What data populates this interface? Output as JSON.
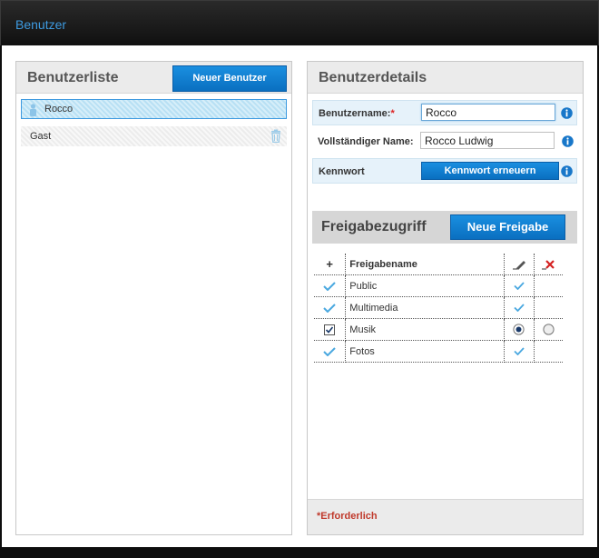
{
  "app": {
    "title": "Benutzer"
  },
  "user_list": {
    "title": "Benutzerliste",
    "new_user_label": "Neuer Benutzer",
    "users": [
      {
        "name": "Rocco",
        "selected": true
      },
      {
        "name": "Gast",
        "selected": false
      }
    ]
  },
  "user_details": {
    "title": "Benutzerdetails",
    "username_label": "Benutzername:",
    "username_required": "*",
    "username_value": "Rocco",
    "fullname_label": "Vollständiger Name:",
    "fullname_value": "Rocco Ludwig",
    "password_label": "Kennwort",
    "renew_password_label": "Kennwort erneuern"
  },
  "shares": {
    "title": "Freigabezugriff",
    "new_share_label": "Neue Freigabe",
    "header": {
      "add": "+",
      "name": "Freigabename"
    },
    "rows": [
      {
        "name": "Public",
        "access": "read-write",
        "selected": false
      },
      {
        "name": "Multimedia",
        "access": "read-write",
        "selected": false
      },
      {
        "name": "Musik",
        "access": "read-write",
        "selected": true
      },
      {
        "name": "Fotos",
        "access": "read-write",
        "selected": false
      }
    ]
  },
  "footer": {
    "required_note": "*Erforderlich"
  },
  "colors": {
    "accent": "#3d9ae0",
    "button": "#0a76cc",
    "required": "#c0392b"
  }
}
